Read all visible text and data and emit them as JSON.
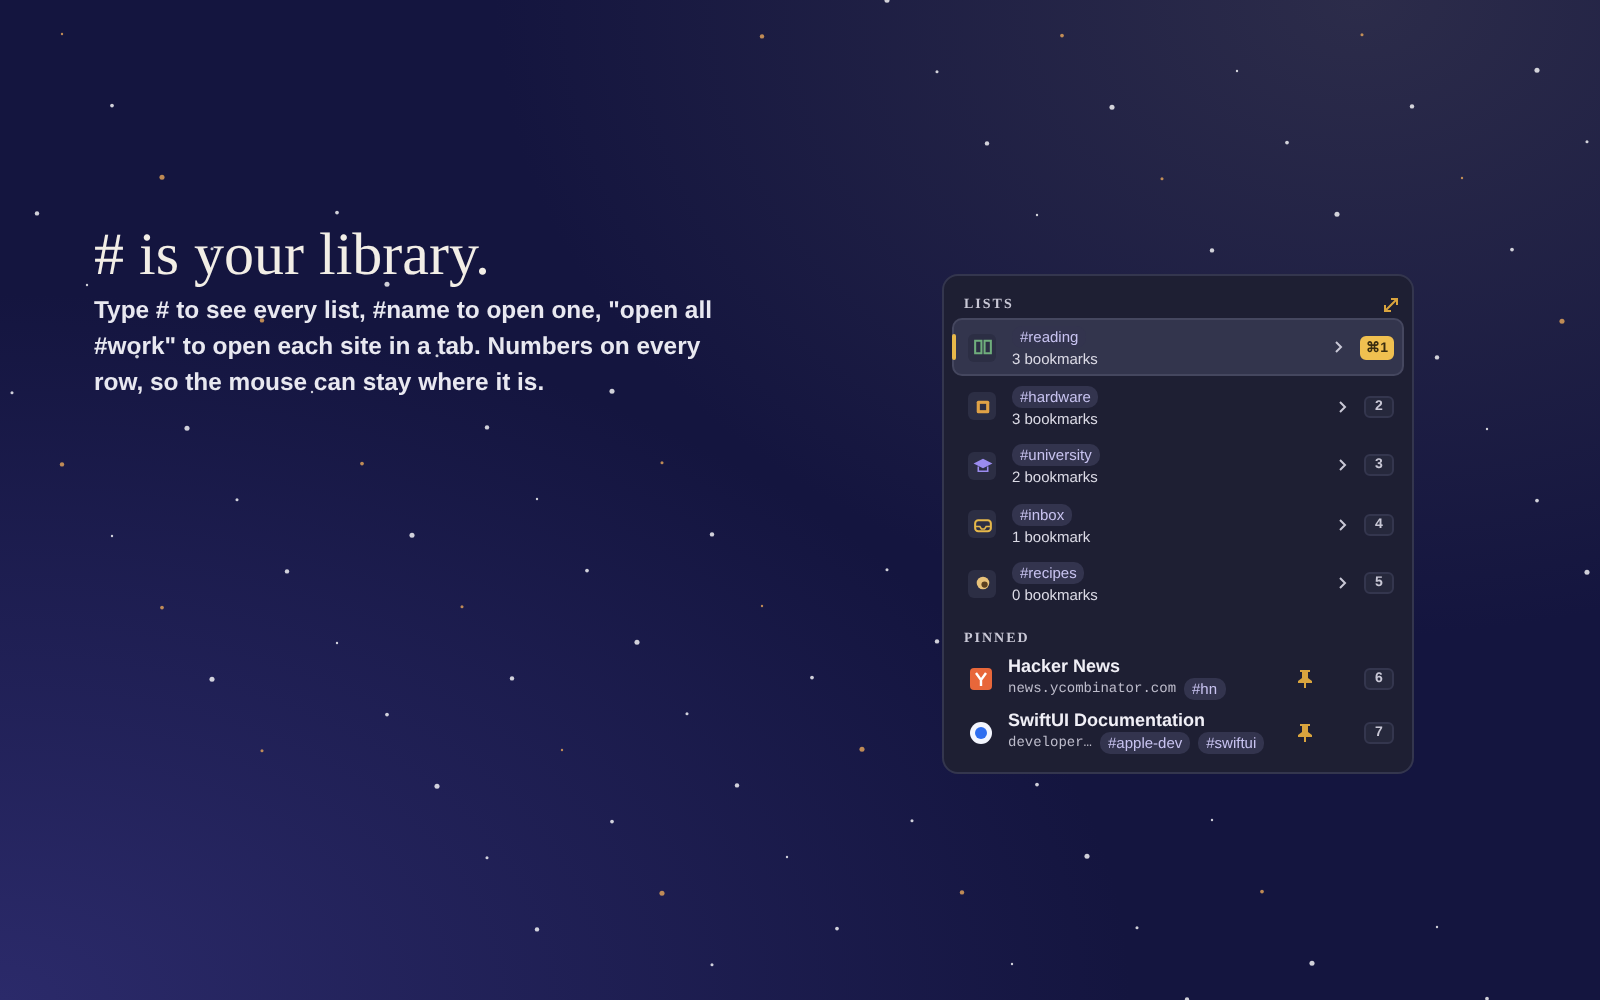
{
  "hero": {
    "title": "# is your library.",
    "body": "Type # to see every list, #name to open one, \"open all #work\" to open each site in a tab. Numbers on every row, so the mouse can stay where it is."
  },
  "popup": {
    "lists_heading": "LISTS",
    "lists": [
      {
        "tag": "#reading",
        "count": "3 bookmarks",
        "kind": "book",
        "color": "#6fae7c",
        "shortcut": "⌘1",
        "selected": true
      },
      {
        "tag": "#hardware",
        "count": "3 bookmarks",
        "kind": "chip",
        "color": "#e0a246",
        "shortcut": "2",
        "selected": false
      },
      {
        "tag": "#university",
        "count": "2 bookmarks",
        "kind": "cap",
        "color": "#9b8cf0",
        "shortcut": "3",
        "selected": false
      },
      {
        "tag": "#inbox",
        "count": "1 bookmark",
        "kind": "tray",
        "color": "#e6b84a",
        "shortcut": "4",
        "selected": false
      },
      {
        "tag": "#recipes",
        "count": "0 bookmarks",
        "kind": "bowl",
        "color": "#e8c27a",
        "shortcut": "5",
        "selected": false
      }
    ],
    "pinned_heading": "PINNED",
    "pinned": [
      {
        "title": "Hacker News",
        "url": "news.ycombinator.com",
        "tags": [
          "#hn"
        ],
        "kind": "y",
        "shortcut": "6"
      },
      {
        "title": "SwiftUI Documentation",
        "url": "developer…",
        "tags": [
          "#apple-dev",
          "#swiftui"
        ],
        "kind": "globe",
        "shortcut": "7"
      }
    ]
  }
}
